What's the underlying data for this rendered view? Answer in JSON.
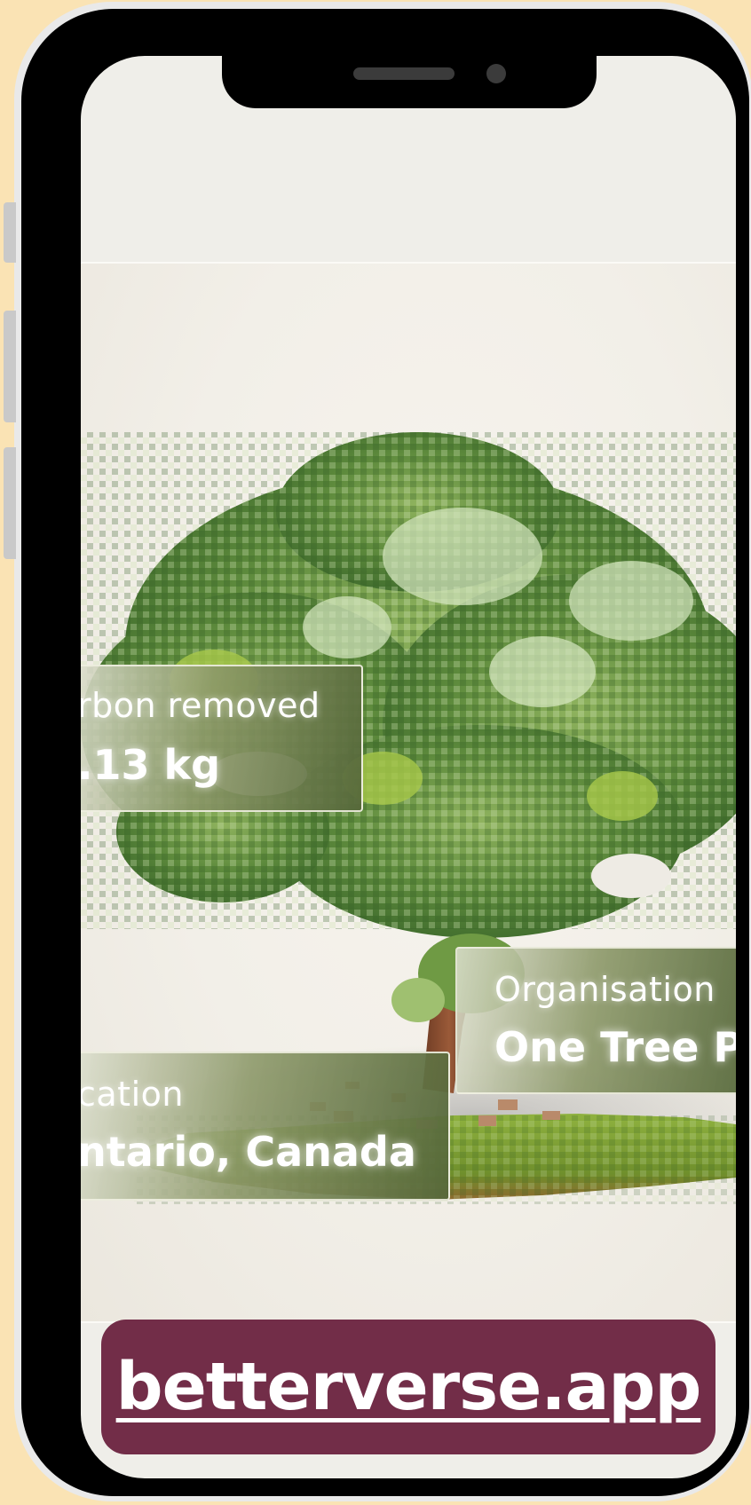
{
  "theme": {
    "page_background": "#fae3b4",
    "screen_background": "#efeee9",
    "banner_color": "#722d48",
    "card_tint": "#56683a"
  },
  "cards": {
    "carbon": {
      "label": "rbon removed",
      "value": ".13 kg"
    },
    "organisation": {
      "label": "Organisation",
      "value": "One Tree Pl"
    },
    "location": {
      "label": "cation",
      "value": "ntario, Canada"
    }
  },
  "media": {
    "icon": "voxel-tree-illustration"
  },
  "footer": {
    "link_text": "betterverse.app"
  }
}
